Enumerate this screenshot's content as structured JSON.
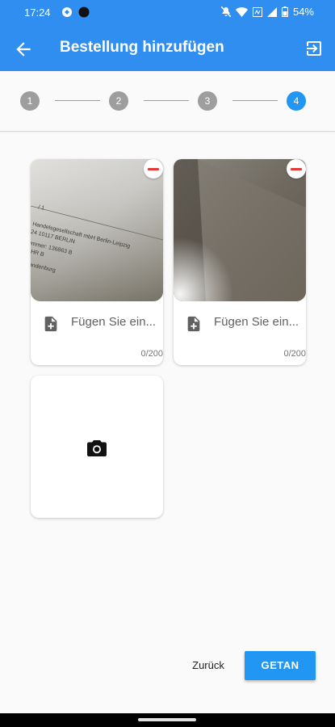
{
  "status_bar": {
    "time": "17:24",
    "battery": "54%"
  },
  "app_bar": {
    "title": "Bestellung hinzufügen",
    "back_icon": "arrow-left-icon",
    "exit_icon": "exit-to-app-icon"
  },
  "stepper": {
    "steps": [
      "1",
      "2",
      "3",
      "4"
    ],
    "active_step": "4"
  },
  "cards": [
    {
      "note_placeholder": "Fügen Sie ein...",
      "counter": "0/200",
      "photo_text": [
        "/ 1",
        "Handelsgesellschaft mbH Berlin-Leipzig",
        "24 10117 BERLIN",
        "ummer: 136863 B",
        "i, HR B",
        "Brandenburg"
      ]
    },
    {
      "note_placeholder": "Fügen Sie ein...",
      "counter": "0/200"
    }
  ],
  "add_photo": {
    "icon": "camera-icon"
  },
  "footer": {
    "back_label": "Zurück",
    "done_label": "GETAN"
  },
  "colors": {
    "primary": "#2f8ef0",
    "active_step": "#2196f3",
    "inactive_step": "#9e9e9e",
    "remove": "#e53935"
  }
}
